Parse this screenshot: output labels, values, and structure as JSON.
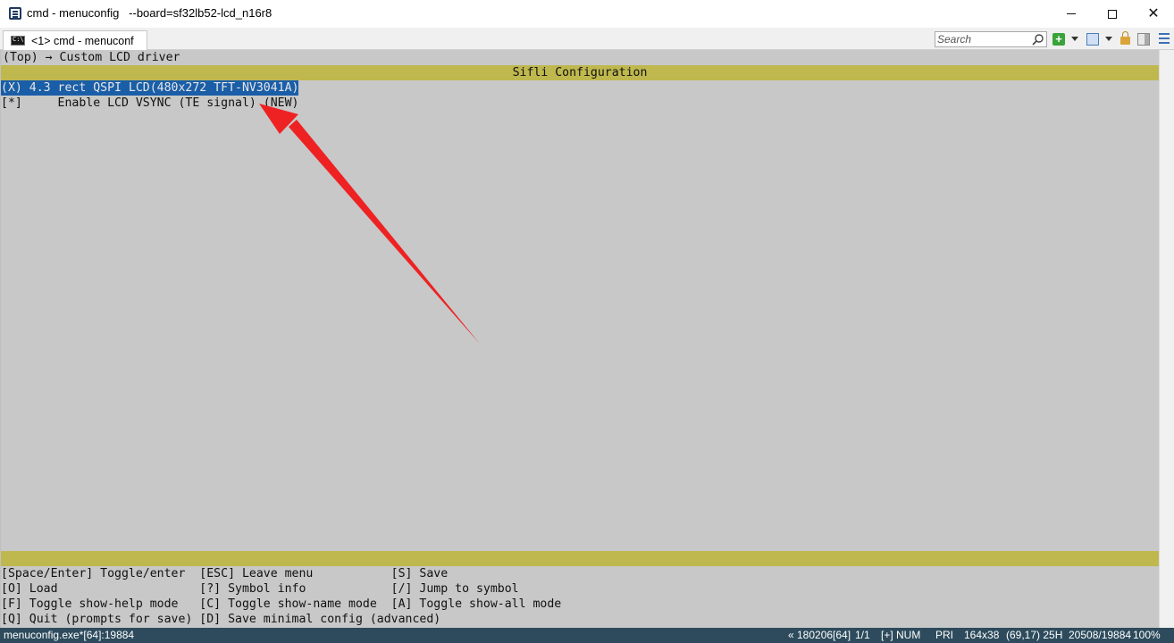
{
  "window": {
    "title": "cmd - menuconfig   --board=sf32lb52-lcd_n16r8",
    "icon": "console-app-icon"
  },
  "tabbar": {
    "tab_label": "<1> cmd - menuconf",
    "search_placeholder": "Search"
  },
  "terminal": {
    "breadcrumb": "(Top) → Custom LCD driver",
    "header_title": "Sifli Configuration",
    "options": [
      {
        "text": "(X) 4.3 rect QSPI LCD(480x272 TFT-NV3041A)",
        "selected": true
      },
      {
        "text": "[*]     Enable LCD VSYNC (TE signal) (NEW)",
        "selected": false
      }
    ],
    "help_lines": [
      "[Space/Enter] Toggle/enter  [ESC] Leave menu           [S] Save",
      "[O] Load                    [?] Symbol info            [/] Jump to symbol",
      "[F] Toggle show-help mode   [C] Toggle show-name mode  [A] Toggle show-all mode",
      "[Q] Quit (prompts for save) [D] Save minimal config (advanced)"
    ],
    "colors": {
      "background": "#c8c8c8",
      "band": "#bfb84e",
      "selection": "#1a5ea8",
      "annotation_arrow": "#ee2222"
    }
  },
  "statusbar": {
    "process": "menuconfig.exe*[64]:19884",
    "buffer": "« 180206[64]",
    "page": "1/1",
    "mode": "[+] NUM",
    "priority": "PRI",
    "size": "164x38",
    "cursor": "(69,17) 25H",
    "memory": "20508/19884",
    "zoom": "100%"
  }
}
